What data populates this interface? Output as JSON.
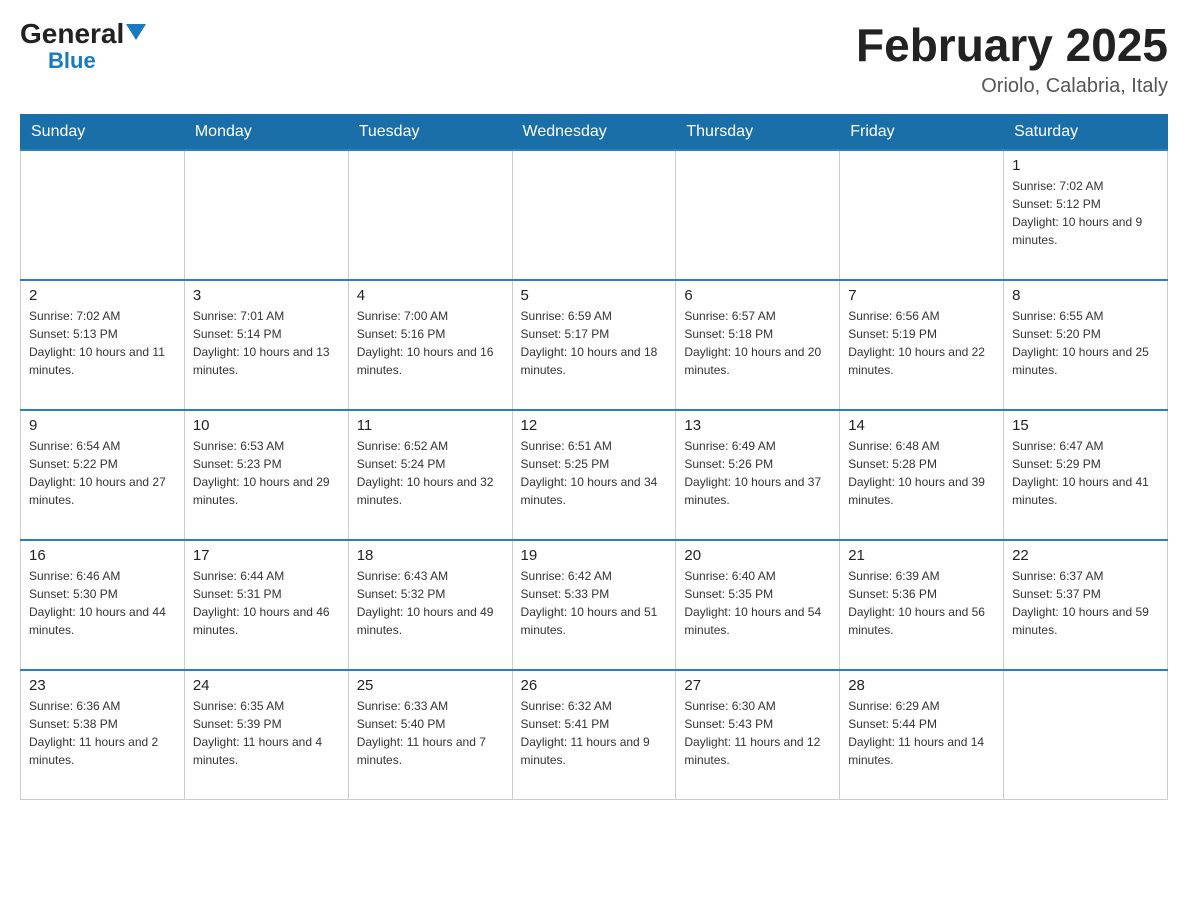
{
  "header": {
    "logo_general": "General",
    "logo_blue": "Blue",
    "month_year": "February 2025",
    "location": "Oriolo, Calabria, Italy"
  },
  "days_of_week": [
    "Sunday",
    "Monday",
    "Tuesday",
    "Wednesday",
    "Thursday",
    "Friday",
    "Saturday"
  ],
  "weeks": [
    [
      {
        "day": "",
        "info": ""
      },
      {
        "day": "",
        "info": ""
      },
      {
        "day": "",
        "info": ""
      },
      {
        "day": "",
        "info": ""
      },
      {
        "day": "",
        "info": ""
      },
      {
        "day": "",
        "info": ""
      },
      {
        "day": "1",
        "info": "Sunrise: 7:02 AM\nSunset: 5:12 PM\nDaylight: 10 hours and 9 minutes."
      }
    ],
    [
      {
        "day": "2",
        "info": "Sunrise: 7:02 AM\nSunset: 5:13 PM\nDaylight: 10 hours and 11 minutes."
      },
      {
        "day": "3",
        "info": "Sunrise: 7:01 AM\nSunset: 5:14 PM\nDaylight: 10 hours and 13 minutes."
      },
      {
        "day": "4",
        "info": "Sunrise: 7:00 AM\nSunset: 5:16 PM\nDaylight: 10 hours and 16 minutes."
      },
      {
        "day": "5",
        "info": "Sunrise: 6:59 AM\nSunset: 5:17 PM\nDaylight: 10 hours and 18 minutes."
      },
      {
        "day": "6",
        "info": "Sunrise: 6:57 AM\nSunset: 5:18 PM\nDaylight: 10 hours and 20 minutes."
      },
      {
        "day": "7",
        "info": "Sunrise: 6:56 AM\nSunset: 5:19 PM\nDaylight: 10 hours and 22 minutes."
      },
      {
        "day": "8",
        "info": "Sunrise: 6:55 AM\nSunset: 5:20 PM\nDaylight: 10 hours and 25 minutes."
      }
    ],
    [
      {
        "day": "9",
        "info": "Sunrise: 6:54 AM\nSunset: 5:22 PM\nDaylight: 10 hours and 27 minutes."
      },
      {
        "day": "10",
        "info": "Sunrise: 6:53 AM\nSunset: 5:23 PM\nDaylight: 10 hours and 29 minutes."
      },
      {
        "day": "11",
        "info": "Sunrise: 6:52 AM\nSunset: 5:24 PM\nDaylight: 10 hours and 32 minutes."
      },
      {
        "day": "12",
        "info": "Sunrise: 6:51 AM\nSunset: 5:25 PM\nDaylight: 10 hours and 34 minutes."
      },
      {
        "day": "13",
        "info": "Sunrise: 6:49 AM\nSunset: 5:26 PM\nDaylight: 10 hours and 37 minutes."
      },
      {
        "day": "14",
        "info": "Sunrise: 6:48 AM\nSunset: 5:28 PM\nDaylight: 10 hours and 39 minutes."
      },
      {
        "day": "15",
        "info": "Sunrise: 6:47 AM\nSunset: 5:29 PM\nDaylight: 10 hours and 41 minutes."
      }
    ],
    [
      {
        "day": "16",
        "info": "Sunrise: 6:46 AM\nSunset: 5:30 PM\nDaylight: 10 hours and 44 minutes."
      },
      {
        "day": "17",
        "info": "Sunrise: 6:44 AM\nSunset: 5:31 PM\nDaylight: 10 hours and 46 minutes."
      },
      {
        "day": "18",
        "info": "Sunrise: 6:43 AM\nSunset: 5:32 PM\nDaylight: 10 hours and 49 minutes."
      },
      {
        "day": "19",
        "info": "Sunrise: 6:42 AM\nSunset: 5:33 PM\nDaylight: 10 hours and 51 minutes."
      },
      {
        "day": "20",
        "info": "Sunrise: 6:40 AM\nSunset: 5:35 PM\nDaylight: 10 hours and 54 minutes."
      },
      {
        "day": "21",
        "info": "Sunrise: 6:39 AM\nSunset: 5:36 PM\nDaylight: 10 hours and 56 minutes."
      },
      {
        "day": "22",
        "info": "Sunrise: 6:37 AM\nSunset: 5:37 PM\nDaylight: 10 hours and 59 minutes."
      }
    ],
    [
      {
        "day": "23",
        "info": "Sunrise: 6:36 AM\nSunset: 5:38 PM\nDaylight: 11 hours and 2 minutes."
      },
      {
        "day": "24",
        "info": "Sunrise: 6:35 AM\nSunset: 5:39 PM\nDaylight: 11 hours and 4 minutes."
      },
      {
        "day": "25",
        "info": "Sunrise: 6:33 AM\nSunset: 5:40 PM\nDaylight: 11 hours and 7 minutes."
      },
      {
        "day": "26",
        "info": "Sunrise: 6:32 AM\nSunset: 5:41 PM\nDaylight: 11 hours and 9 minutes."
      },
      {
        "day": "27",
        "info": "Sunrise: 6:30 AM\nSunset: 5:43 PM\nDaylight: 11 hours and 12 minutes."
      },
      {
        "day": "28",
        "info": "Sunrise: 6:29 AM\nSunset: 5:44 PM\nDaylight: 11 hours and 14 minutes."
      },
      {
        "day": "",
        "info": ""
      }
    ]
  ]
}
